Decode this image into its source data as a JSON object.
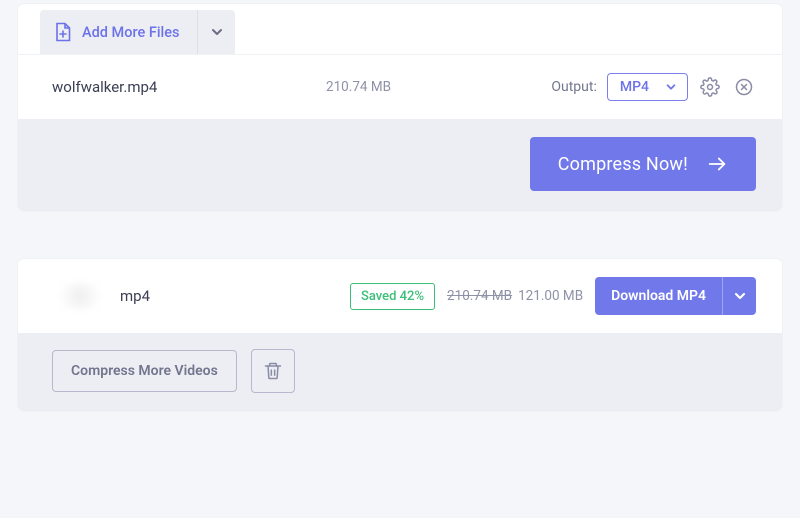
{
  "upload": {
    "add_more_label": "Add More Files",
    "file": {
      "name": "wolfwalker.mp4",
      "size": "210.74 MB"
    },
    "output_label": "Output:",
    "output_format": "MP4",
    "compress_label": "Compress Now!"
  },
  "result": {
    "file_ext": "mp4",
    "saved_label": "Saved 42%",
    "size_before": "210.74 MB",
    "size_after": "121.00 MB",
    "download_label": "Download MP4",
    "more_videos_label": "Compress More Videos"
  }
}
